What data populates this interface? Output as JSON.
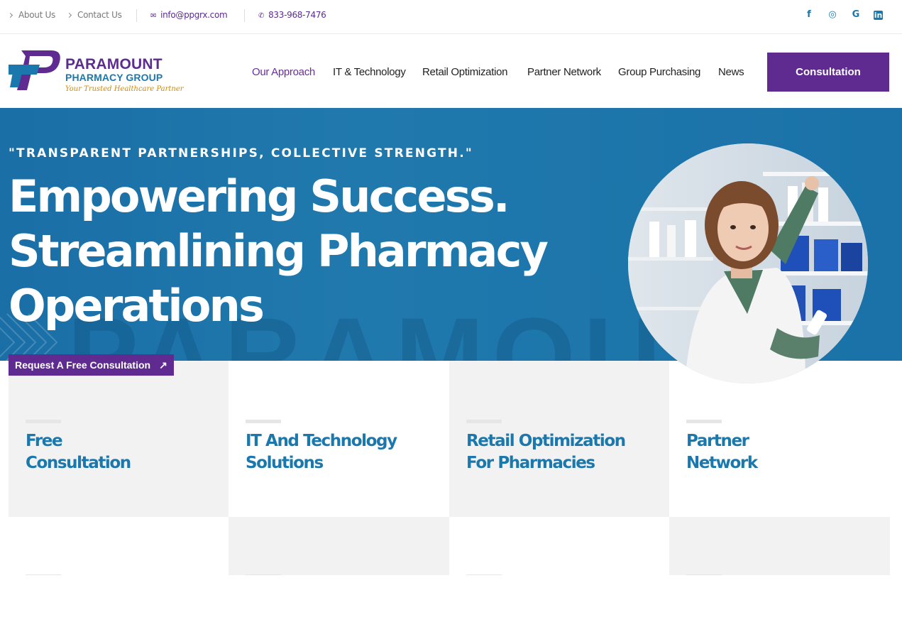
{
  "topbar": {
    "links": [
      {
        "label": "About Us"
      },
      {
        "label": "Contact Us"
      }
    ],
    "email": "info@ppgrx.com",
    "phone": "833-968-7476",
    "social": [
      {
        "icon": "facebook-icon",
        "glyph": "f"
      },
      {
        "icon": "instagram-icon",
        "glyph": "◎"
      },
      {
        "icon": "google-icon",
        "glyph": "G"
      },
      {
        "icon": "linkedin-icon",
        "glyph": "in"
      }
    ]
  },
  "header": {
    "logo": {
      "line1": "PARAMOUNT",
      "line2": "PHARMACY GROUP",
      "tagline": "Your Trusted Healthcare Partner"
    },
    "nav": [
      {
        "label": "Our Approach",
        "active": true
      },
      {
        "label": "IT & Technology"
      },
      {
        "label": "Retail Optimization"
      },
      {
        "label": "Partner Network"
      },
      {
        "label": "Group Purchasing"
      },
      {
        "label": "News"
      }
    ],
    "cta_label": "Consultation"
  },
  "hero": {
    "tagline": "\"TRANSPARENT PARTNERSHIPS, COLLECTIVE STRENGTH.\"",
    "headline": [
      "Empowering Success.",
      "Streamlining Pharmacy",
      "Operations"
    ],
    "watermark": "PARAMOUNT",
    "cta_label": "Request A Free Consultation"
  },
  "cards": [
    {
      "title_lines": [
        "Free",
        "Consultation"
      ]
    },
    {
      "title_lines": [
        "IT And Technology",
        "Solutions"
      ]
    },
    {
      "title_lines": [
        "Retail Optimization",
        "For Pharmacies"
      ]
    },
    {
      "title_lines": [
        "Partner",
        "Network"
      ]
    }
  ],
  "colors": {
    "brand_purple": "#5f2b91",
    "brand_blue": "#1b78ad",
    "card_gray": "#f2f2f2"
  }
}
